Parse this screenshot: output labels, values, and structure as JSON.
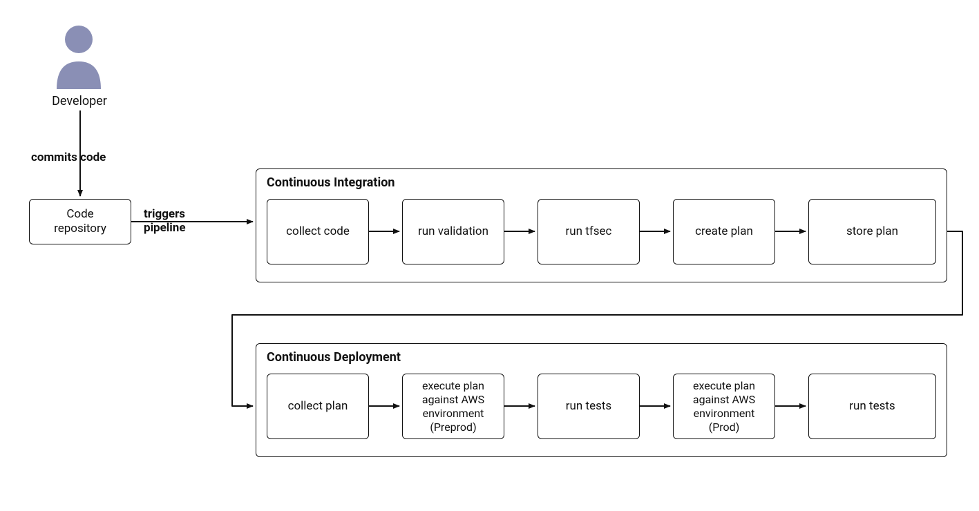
{
  "actor": {
    "label": "Developer"
  },
  "edges": {
    "commits": "commits code",
    "triggers_line1": "triggers",
    "triggers_line2": "pipeline"
  },
  "repo": {
    "label_line1": "Code",
    "label_line2": "repository"
  },
  "ci": {
    "title": "Continuous Integration",
    "steps": [
      "collect code",
      "run validation",
      "run tfsec",
      "create plan",
      "store plan"
    ]
  },
  "cd": {
    "title": "Continuous Deployment",
    "steps": [
      "collect plan",
      "execute plan against AWS environment (Preprod)",
      "run tests",
      "execute plan against AWS environment (Prod)",
      "run tests"
    ]
  },
  "colors": {
    "actor": "#8a8fb5"
  }
}
